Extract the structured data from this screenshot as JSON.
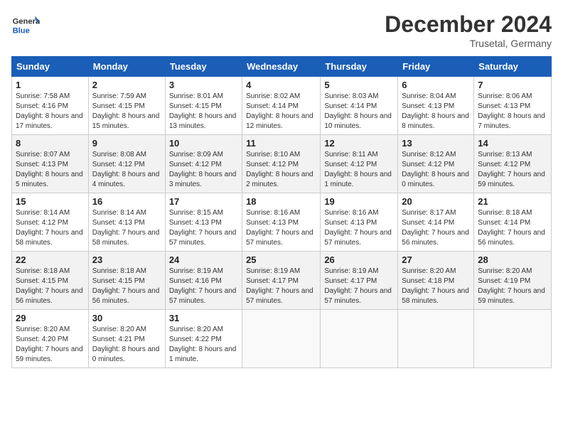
{
  "header": {
    "logo_general": "General",
    "logo_blue": "Blue",
    "month_title": "December 2024",
    "location": "Trusetal, Germany"
  },
  "weekdays": [
    "Sunday",
    "Monday",
    "Tuesday",
    "Wednesday",
    "Thursday",
    "Friday",
    "Saturday"
  ],
  "weeks": [
    [
      {
        "day": "1",
        "sunrise": "Sunrise: 7:58 AM",
        "sunset": "Sunset: 4:16 PM",
        "daylight": "Daylight: 8 hours and 17 minutes."
      },
      {
        "day": "2",
        "sunrise": "Sunrise: 7:59 AM",
        "sunset": "Sunset: 4:15 PM",
        "daylight": "Daylight: 8 hours and 15 minutes."
      },
      {
        "day": "3",
        "sunrise": "Sunrise: 8:01 AM",
        "sunset": "Sunset: 4:15 PM",
        "daylight": "Daylight: 8 hours and 13 minutes."
      },
      {
        "day": "4",
        "sunrise": "Sunrise: 8:02 AM",
        "sunset": "Sunset: 4:14 PM",
        "daylight": "Daylight: 8 hours and 12 minutes."
      },
      {
        "day": "5",
        "sunrise": "Sunrise: 8:03 AM",
        "sunset": "Sunset: 4:14 PM",
        "daylight": "Daylight: 8 hours and 10 minutes."
      },
      {
        "day": "6",
        "sunrise": "Sunrise: 8:04 AM",
        "sunset": "Sunset: 4:13 PM",
        "daylight": "Daylight: 8 hours and 8 minutes."
      },
      {
        "day": "7",
        "sunrise": "Sunrise: 8:06 AM",
        "sunset": "Sunset: 4:13 PM",
        "daylight": "Daylight: 8 hours and 7 minutes."
      }
    ],
    [
      {
        "day": "8",
        "sunrise": "Sunrise: 8:07 AM",
        "sunset": "Sunset: 4:13 PM",
        "daylight": "Daylight: 8 hours and 5 minutes."
      },
      {
        "day": "9",
        "sunrise": "Sunrise: 8:08 AM",
        "sunset": "Sunset: 4:12 PM",
        "daylight": "Daylight: 8 hours and 4 minutes."
      },
      {
        "day": "10",
        "sunrise": "Sunrise: 8:09 AM",
        "sunset": "Sunset: 4:12 PM",
        "daylight": "Daylight: 8 hours and 3 minutes."
      },
      {
        "day": "11",
        "sunrise": "Sunrise: 8:10 AM",
        "sunset": "Sunset: 4:12 PM",
        "daylight": "Daylight: 8 hours and 2 minutes."
      },
      {
        "day": "12",
        "sunrise": "Sunrise: 8:11 AM",
        "sunset": "Sunset: 4:12 PM",
        "daylight": "Daylight: 8 hours and 1 minute."
      },
      {
        "day": "13",
        "sunrise": "Sunrise: 8:12 AM",
        "sunset": "Sunset: 4:12 PM",
        "daylight": "Daylight: 8 hours and 0 minutes."
      },
      {
        "day": "14",
        "sunrise": "Sunrise: 8:13 AM",
        "sunset": "Sunset: 4:12 PM",
        "daylight": "Daylight: 7 hours and 59 minutes."
      }
    ],
    [
      {
        "day": "15",
        "sunrise": "Sunrise: 8:14 AM",
        "sunset": "Sunset: 4:12 PM",
        "daylight": "Daylight: 7 hours and 58 minutes."
      },
      {
        "day": "16",
        "sunrise": "Sunrise: 8:14 AM",
        "sunset": "Sunset: 4:13 PM",
        "daylight": "Daylight: 7 hours and 58 minutes."
      },
      {
        "day": "17",
        "sunrise": "Sunrise: 8:15 AM",
        "sunset": "Sunset: 4:13 PM",
        "daylight": "Daylight: 7 hours and 57 minutes."
      },
      {
        "day": "18",
        "sunrise": "Sunrise: 8:16 AM",
        "sunset": "Sunset: 4:13 PM",
        "daylight": "Daylight: 7 hours and 57 minutes."
      },
      {
        "day": "19",
        "sunrise": "Sunrise: 8:16 AM",
        "sunset": "Sunset: 4:13 PM",
        "daylight": "Daylight: 7 hours and 57 minutes."
      },
      {
        "day": "20",
        "sunrise": "Sunrise: 8:17 AM",
        "sunset": "Sunset: 4:14 PM",
        "daylight": "Daylight: 7 hours and 56 minutes."
      },
      {
        "day": "21",
        "sunrise": "Sunrise: 8:18 AM",
        "sunset": "Sunset: 4:14 PM",
        "daylight": "Daylight: 7 hours and 56 minutes."
      }
    ],
    [
      {
        "day": "22",
        "sunrise": "Sunrise: 8:18 AM",
        "sunset": "Sunset: 4:15 PM",
        "daylight": "Daylight: 7 hours and 56 minutes."
      },
      {
        "day": "23",
        "sunrise": "Sunrise: 8:18 AM",
        "sunset": "Sunset: 4:15 PM",
        "daylight": "Daylight: 7 hours and 56 minutes."
      },
      {
        "day": "24",
        "sunrise": "Sunrise: 8:19 AM",
        "sunset": "Sunset: 4:16 PM",
        "daylight": "Daylight: 7 hours and 57 minutes."
      },
      {
        "day": "25",
        "sunrise": "Sunrise: 8:19 AM",
        "sunset": "Sunset: 4:17 PM",
        "daylight": "Daylight: 7 hours and 57 minutes."
      },
      {
        "day": "26",
        "sunrise": "Sunrise: 8:19 AM",
        "sunset": "Sunset: 4:17 PM",
        "daylight": "Daylight: 7 hours and 57 minutes."
      },
      {
        "day": "27",
        "sunrise": "Sunrise: 8:20 AM",
        "sunset": "Sunset: 4:18 PM",
        "daylight": "Daylight: 7 hours and 58 minutes."
      },
      {
        "day": "28",
        "sunrise": "Sunrise: 8:20 AM",
        "sunset": "Sunset: 4:19 PM",
        "daylight": "Daylight: 7 hours and 59 minutes."
      }
    ],
    [
      {
        "day": "29",
        "sunrise": "Sunrise: 8:20 AM",
        "sunset": "Sunset: 4:20 PM",
        "daylight": "Daylight: 7 hours and 59 minutes."
      },
      {
        "day": "30",
        "sunrise": "Sunrise: 8:20 AM",
        "sunset": "Sunset: 4:21 PM",
        "daylight": "Daylight: 8 hours and 0 minutes."
      },
      {
        "day": "31",
        "sunrise": "Sunrise: 8:20 AM",
        "sunset": "Sunset: 4:22 PM",
        "daylight": "Daylight: 8 hours and 1 minute."
      },
      {
        "day": "",
        "sunrise": "",
        "sunset": "",
        "daylight": ""
      },
      {
        "day": "",
        "sunrise": "",
        "sunset": "",
        "daylight": ""
      },
      {
        "day": "",
        "sunrise": "",
        "sunset": "",
        "daylight": ""
      },
      {
        "day": "",
        "sunrise": "",
        "sunset": "",
        "daylight": ""
      }
    ]
  ]
}
